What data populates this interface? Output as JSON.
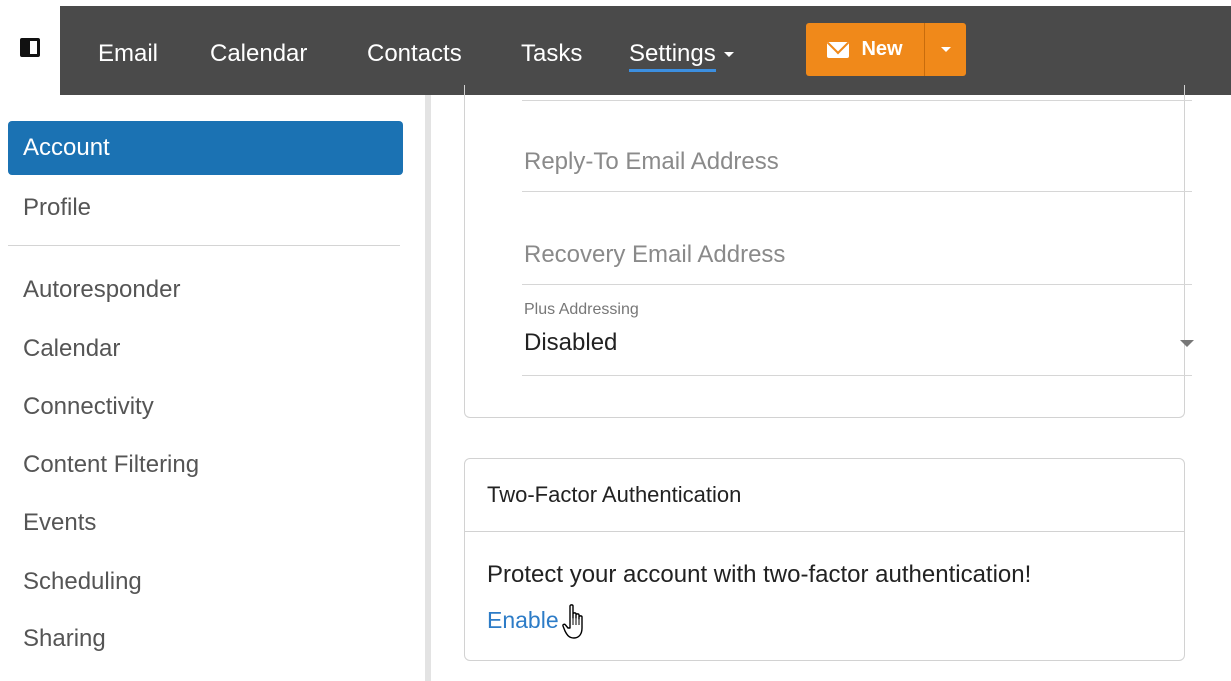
{
  "nav": {
    "items": [
      {
        "label": "Email"
      },
      {
        "label": "Calendar"
      },
      {
        "label": "Contacts"
      },
      {
        "label": "Tasks"
      },
      {
        "label": "Settings"
      }
    ],
    "new_button": {
      "label": "New"
    },
    "accent_color": "#f0891a"
  },
  "sidebar": {
    "items": [
      {
        "label": "Account",
        "active": true
      },
      {
        "label": "Profile"
      },
      {
        "label": "Autoresponder"
      },
      {
        "label": "Calendar"
      },
      {
        "label": "Connectivity"
      },
      {
        "label": "Content Filtering"
      },
      {
        "label": "Events"
      },
      {
        "label": "Scheduling"
      },
      {
        "label": "Sharing"
      }
    ],
    "active_color": "#1b72b3"
  },
  "account_card": {
    "reply_to_placeholder": "Reply-To Email Address",
    "recovery_placeholder": "Recovery Email Address",
    "plus_addressing_label": "Plus Addressing",
    "plus_addressing_value": "Disabled"
  },
  "two_factor": {
    "title": "Two-Factor Authentication",
    "message": "Protect your account with two-factor authentication!",
    "enable_link": "Enable",
    "link_color": "#2d7cc7"
  }
}
